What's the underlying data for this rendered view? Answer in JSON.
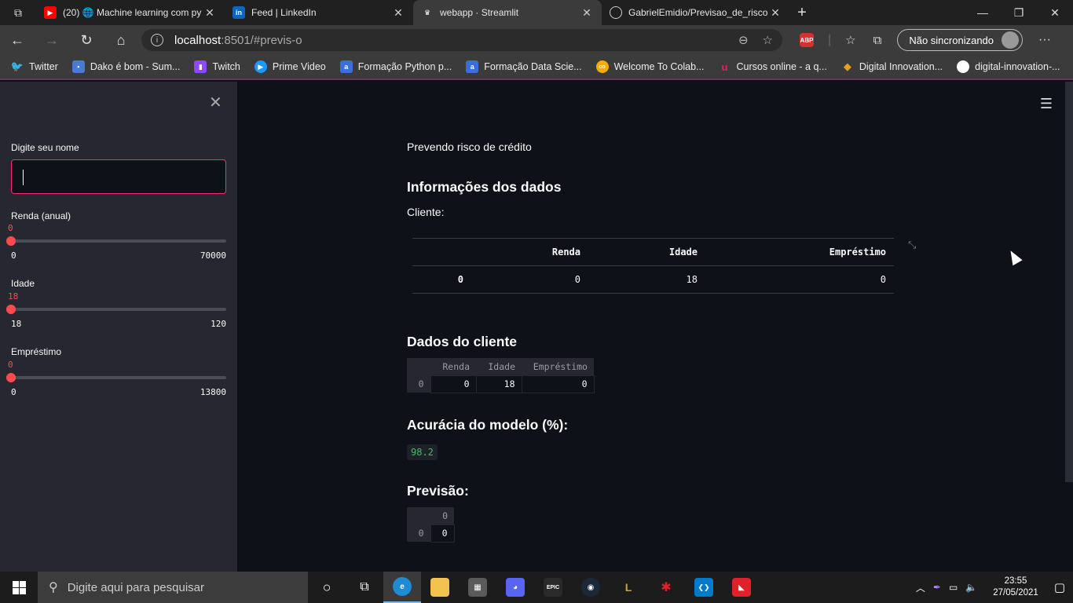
{
  "browser": {
    "tabs": [
      {
        "title": "(20) 🌐 Machine learning com py",
        "favicon": "youtube-icon",
        "color": "#ff0000",
        "glyph": "▶"
      },
      {
        "title": "Feed | LinkedIn",
        "favicon": "linkedin-icon",
        "color": "#0a66c2",
        "glyph": "in"
      },
      {
        "title": "webapp · Streamlit",
        "favicon": "streamlit-icon",
        "color": "#3b3b3b",
        "glyph": "♛"
      },
      {
        "title": "GabrielEmidio/Previsao_de_risco",
        "favicon": "github-icon",
        "color": "#202020",
        "glyph": "●"
      }
    ],
    "url_host": "localhost",
    "url_path": ":8501/#previs-o",
    "sync_label": "Não sincronizando",
    "abp_label": "ABP",
    "bookmarks": [
      {
        "label": "Twitter",
        "icon": "twitter-icon",
        "color": "#1da1f2",
        "glyph": "🐦"
      },
      {
        "label": "Dako é bom - Sum...",
        "icon": "dako-icon",
        "color": "#4a7bd4",
        "glyph": "◼"
      },
      {
        "label": "Twitch",
        "icon": "twitch-icon",
        "color": "#9146ff",
        "glyph": "▮"
      },
      {
        "label": "Prime Video",
        "icon": "prime-video-icon",
        "color": "#1a98ff",
        "glyph": "▶"
      },
      {
        "label": "Formação Python p...",
        "icon": "a-icon",
        "color": "#3b6fd8",
        "glyph": "a"
      },
      {
        "label": "Formação Data Scie...",
        "icon": "a-icon",
        "color": "#3b6fd8",
        "glyph": "a"
      },
      {
        "label": "Welcome To Colab...",
        "icon": "colab-icon",
        "color": "#f9ab00",
        "glyph": "co"
      },
      {
        "label": "Cursos online - a q...",
        "icon": "udemy-icon",
        "color": "#a435f0",
        "glyph": "u"
      },
      {
        "label": "Digital Innovation...",
        "icon": "dio-icon",
        "color": "#e4a11b",
        "glyph": "◆"
      },
      {
        "label": "digital-innovation-...",
        "icon": "github-icon",
        "color": "#202020",
        "glyph": "●"
      }
    ]
  },
  "sidebar": {
    "name_label": "Digite seu nome",
    "sliders": [
      {
        "label": "Renda (anual)",
        "value": "0",
        "min": "0",
        "max": "70000",
        "fraction": 0
      },
      {
        "label": "Idade",
        "value": "18",
        "min": "18",
        "max": "120",
        "fraction": 0
      },
      {
        "label": "Empréstimo",
        "value": "0",
        "min": "0",
        "max": "13800",
        "fraction": 0
      }
    ]
  },
  "main": {
    "intro": "Prevendo risco de crédito",
    "section1": "Informações dos dados",
    "client_label": "Cliente:",
    "table_headers": [
      "",
      "Renda",
      "Idade",
      "Empréstimo"
    ],
    "table_row": [
      "0",
      "0",
      "18",
      "0"
    ],
    "section2": "Dados do cliente",
    "df_headers": [
      "",
      "Renda",
      "Idade",
      "Empréstimo"
    ],
    "df_row": [
      "0",
      "0",
      "18",
      "0"
    ],
    "section3": "Acurácia do modelo (%):",
    "accuracy": "98.2",
    "section4": "Previsão:",
    "pred_header": "0",
    "pred_row": [
      "0",
      "0"
    ]
  },
  "taskbar": {
    "search_placeholder": "Digite aqui para pesquisar",
    "time": "23:55",
    "date": "27/05/2021",
    "apps": [
      {
        "name": "cortana-icon",
        "glyph": "○",
        "color": "transparent"
      },
      {
        "name": "task-view-icon",
        "glyph": "⧉",
        "color": "transparent"
      },
      {
        "name": "edge-icon",
        "glyph": "e",
        "color": "#1e8bd2"
      },
      {
        "name": "file-explorer-icon",
        "glyph": "▬",
        "color": "#f2c14e"
      },
      {
        "name": "store-icon",
        "glyph": "▦",
        "color": "#5a5a5a"
      },
      {
        "name": "discord-icon",
        "glyph": "◕",
        "color": "#5865f2"
      },
      {
        "name": "epic-games-icon",
        "glyph": "EPIC",
        "color": "#2a2a2a"
      },
      {
        "name": "steam-icon",
        "glyph": "◉",
        "color": "#1b2838"
      },
      {
        "name": "league-icon",
        "glyph": "L",
        "color": "#1a1a1a"
      },
      {
        "name": "valorant-icon",
        "glyph": "✱",
        "color": "#1a1a1a"
      },
      {
        "name": "vscode-icon",
        "glyph": "❮❯",
        "color": "#007acc"
      },
      {
        "name": "amd-icon",
        "glyph": "◣",
        "color": "#e0202a"
      }
    ]
  }
}
